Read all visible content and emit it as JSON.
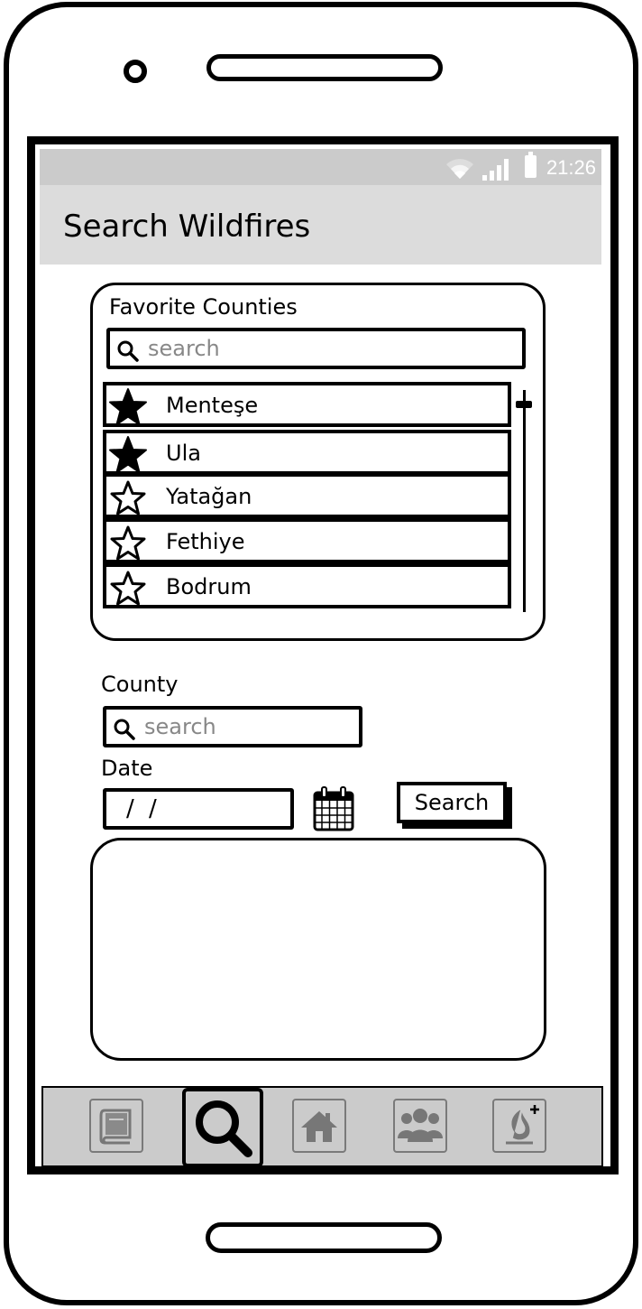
{
  "status_bar": {
    "time": "21:26",
    "icons": [
      "wifi-icon",
      "signal-icon",
      "battery-icon"
    ]
  },
  "app_bar": {
    "title": "Search Wildfires"
  },
  "favorites": {
    "label": "Favorite Counties",
    "search_placeholder": "search",
    "counties": [
      {
        "name": "Menteşe",
        "favorited": true
      },
      {
        "name": "Ula",
        "favorited": true
      },
      {
        "name": "Yatağan",
        "favorited": false
      },
      {
        "name": "Fethiye",
        "favorited": false
      },
      {
        "name": "Bodrum",
        "favorited": false
      }
    ]
  },
  "form": {
    "county_label": "County",
    "county_placeholder": "search",
    "date_label": "Date",
    "date_value": "/ /",
    "search_button": "Search"
  },
  "bottom_nav": {
    "items": [
      {
        "icon": "book-icon",
        "active": false
      },
      {
        "icon": "search-icon",
        "active": true
      },
      {
        "icon": "home-icon",
        "active": false
      },
      {
        "icon": "group-icon",
        "active": false
      },
      {
        "icon": "report-fire-icon",
        "active": false
      }
    ]
  },
  "colors": {
    "status_bar_bg": "#cbcbcb",
    "app_bar_bg": "#dcdcdc",
    "nav_bg": "#cbcbcb"
  }
}
